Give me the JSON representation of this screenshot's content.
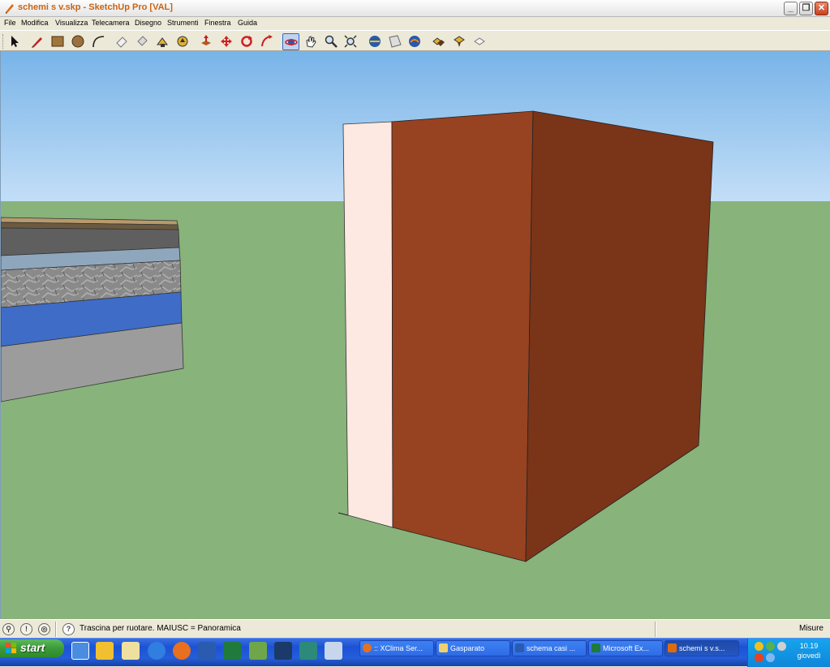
{
  "window": {
    "title": "schemi s v.skp - SketchUp Pro [VAL]",
    "controls": {
      "minimize": "_",
      "restore": "❐",
      "close": "✕"
    }
  },
  "menu": [
    "File",
    "Modifica",
    "Visualizza",
    "Telecamera",
    "Disegno",
    "Strumenti",
    "Finestra",
    "Guida"
  ],
  "toolbar": {
    "tools": [
      "select-icon",
      "pencil-icon",
      "rectangle-icon",
      "circle-icon",
      "arc-icon",
      "eraser-icon",
      "paint-bucket-icon",
      "follow-me-icon",
      "push-pull-icon",
      "offset-icon",
      "move-icon",
      "rotate-icon",
      "scale-icon",
      "orbit-icon",
      "pan-icon",
      "zoom-icon",
      "zoom-extents-icon",
      "section-plane-icon",
      "walk-icon",
      "look-around-icon",
      "components-icon",
      "get-models-icon",
      "share-model-icon"
    ],
    "active_tool": "orbit-icon"
  },
  "colors": {
    "sky_top": "#78b4e8",
    "sky_bottom": "#c3def7",
    "ground": "#88b37b",
    "box_front": "#974220",
    "box_side": "#7a3418",
    "box_panel": "#fde8e2"
  },
  "status": {
    "hint": "Trascina per ruotare. MAIUSC = Panoramica",
    "measures_label": "Misure"
  },
  "taskbar": {
    "start_label": "start",
    "tasks": [
      {
        "label": ":: XClima Ser..."
      },
      {
        "label": "Gasparato"
      },
      {
        "label": "schema casi ..."
      },
      {
        "label": "Microsoft Ex..."
      },
      {
        "label": "schemi s v.s..."
      }
    ],
    "active_task": 4,
    "clock": {
      "time": "10.19",
      "day": "giovedì"
    }
  }
}
